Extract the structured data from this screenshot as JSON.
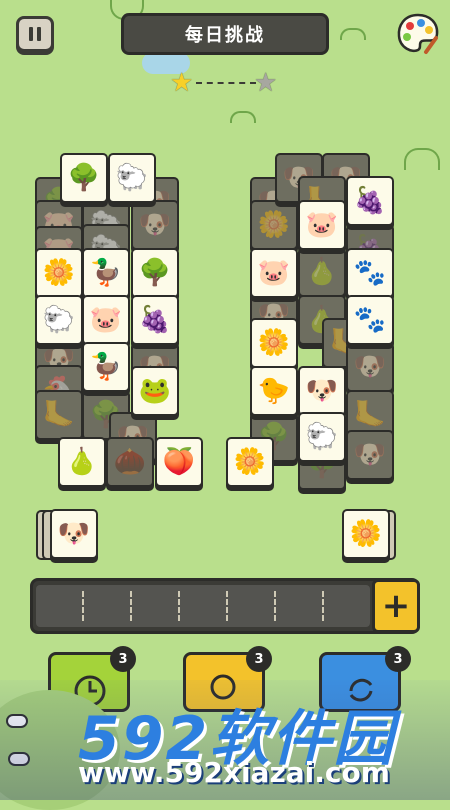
{
  "header": {
    "title": "每日挑战"
  },
  "progress": {
    "stars_collected": 1,
    "stars_total": 2
  },
  "colors": {
    "background": "#b9df8c",
    "tile_face": "#fdfbe9",
    "tile_dim": "#6e6e60",
    "tray": "#3b3b36",
    "plus_button": "#f3c22b",
    "powerup_1": "#a4d33a",
    "powerup_2": "#f3c22b",
    "powerup_3": "#3b8fe0"
  },
  "tray": {
    "slots": 7,
    "filled": 0,
    "plus_label": "+"
  },
  "powerups": [
    {
      "name": "undo",
      "count": "3"
    },
    {
      "name": "hint",
      "count": "3"
    },
    {
      "name": "shuffle",
      "count": "3"
    }
  ],
  "tiles": {
    "left_top": [
      "bush",
      "sheep"
    ],
    "left_grid": [
      [
        "flower",
        "duck",
        "bush"
      ],
      [
        "sheep",
        "pig",
        "grapes"
      ],
      [
        "",
        "duck",
        ""
      ],
      [
        "",
        "",
        "frog"
      ]
    ],
    "right_grid": [
      [
        "",
        "grapes"
      ],
      [
        "pig",
        ""
      ],
      [
        "pig",
        "footprint"
      ],
      [
        "",
        "footprint"
      ],
      [
        "flower",
        ""
      ],
      [
        "chick",
        "pug"
      ],
      [
        "",
        "sheep"
      ]
    ],
    "bottom_row": [
      "pear",
      "peach",
      "flower"
    ],
    "side_stacks": [
      "pug",
      "flower"
    ]
  },
  "watermark": {
    "brand": "592软件园",
    "url": "www.592xiazai.com"
  }
}
